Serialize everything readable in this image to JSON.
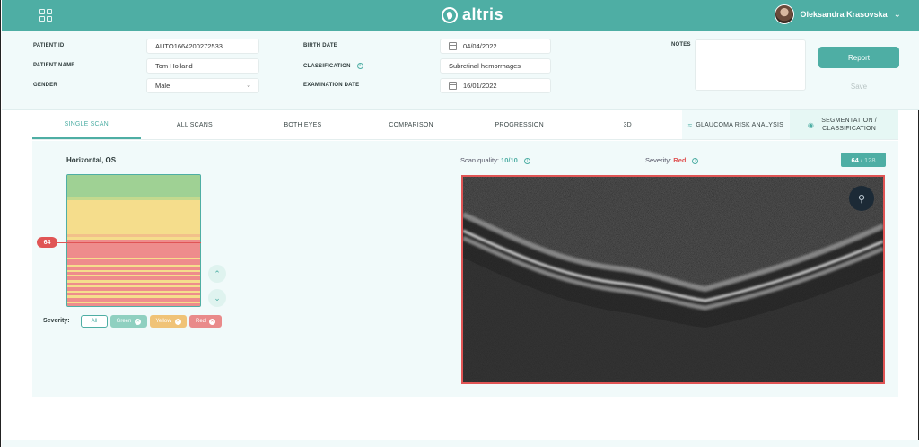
{
  "header": {
    "logo_text": "altris",
    "user_name": "Oleksandra Krasovska",
    "brand_color": "#4eaea4"
  },
  "patient": {
    "id_label": "PATIENT ID",
    "id_value": "AUTO1664200272533",
    "name_label": "PATIENT NAME",
    "name_value": "Tom Holland",
    "gender_label": "GENDER",
    "gender_value": "Male",
    "birth_label": "BIRTH DATE",
    "birth_value": "04/04/2022",
    "classification_label": "CLASSIFICATION",
    "classification_value": "Subretinal hemorrhages",
    "exam_label": "EXAMINATION DATE",
    "exam_value": "16/01/2022",
    "notes_label": "NOTES",
    "report_label": "Report",
    "save_label": "Save"
  },
  "tabs": [
    {
      "label": "SINGLE SCAN",
      "active": true
    },
    {
      "label": "ALL SCANS"
    },
    {
      "label": "BOTH EYES"
    },
    {
      "label": "COMPARISON"
    },
    {
      "label": "PROGRESSION"
    },
    {
      "label": "3D"
    },
    {
      "label": "GLAUCOMA RISK ANALYSIS"
    },
    {
      "label": "SEGMENTATION / CLASSIFICATION"
    }
  ],
  "scan": {
    "title": "Horizontal, OS",
    "quality_label": "Scan quality:",
    "quality_value": "10/10",
    "severity_label": "Severity:",
    "severity_value": "Red",
    "current_scan": "64",
    "total_scans": "/ 128",
    "indicator": "64",
    "filter_label": "Severity:",
    "filters": [
      "All",
      "Green",
      "Yellow",
      "Red"
    ],
    "colors": {
      "green": "#9fd194",
      "yellow": "#f5dd8c",
      "red": "#ee8c8c",
      "accent": "#4eaea4"
    }
  }
}
